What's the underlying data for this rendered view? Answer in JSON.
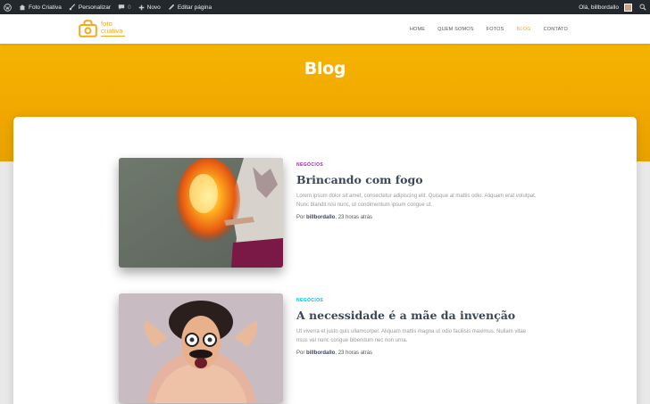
{
  "adminbar": {
    "site_name": "Foto Criativa",
    "customize": "Personalizar",
    "comments_count": "0",
    "new_label": "Novo",
    "edit_page": "Editar página",
    "greeting": "Olá, billbordallo"
  },
  "header": {
    "logo_line1": "foto",
    "logo_line2": "criativa",
    "nav": [
      "HOME",
      "QUEM SOMOS",
      "FOTOS",
      "BLOG",
      "CONTATO"
    ],
    "active_nav": "BLOG",
    "accent": "#f4a81b"
  },
  "hero": {
    "title": "Blog"
  },
  "posts": [
    {
      "category": "NEGÓCIOS",
      "category_color": "#9c27b0",
      "title": "Brincando com fogo",
      "excerpt": "Lorem ipsum dolor sit amet, consectetur adipiscing elit. Quisque at mattis odio. Aliquam erat volutpat. Nunc blandit nisi nunc, ut condimentum ipsum congue ut.",
      "author_prefix": "Por",
      "author": "billbordallo",
      "time": ", 23 horas atrás",
      "image": "fire-photo"
    },
    {
      "category": "NEGÓCIOS",
      "category_color": "#00bcd4",
      "title": "A necessidade é a mãe da invenção",
      "excerpt": "Ut viverra et justo quis ullamcorper. Aliquam mattis magna ut odio facilisis maximus. Nullam vitae risus vel nunc congue bibendum nec non urna.",
      "author_prefix": "Por",
      "author": "billbordallo",
      "time": ", 23 horas atrás",
      "image": "funny-man-photo"
    }
  ]
}
